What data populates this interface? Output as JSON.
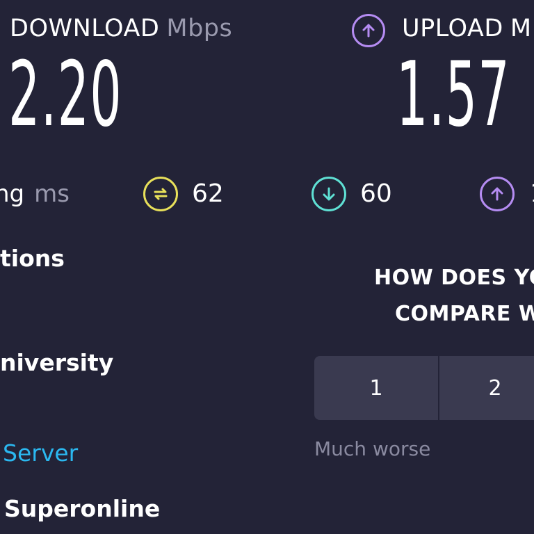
{
  "download": {
    "label": "DOWNLOAD",
    "unit": "Mbps",
    "value": "2.20"
  },
  "upload": {
    "label": "UPLOAD",
    "unit": "M",
    "value": "1.57"
  },
  "latency": {
    "label": "ng",
    "unit": "ms",
    "unloaded": "62",
    "download": "60",
    "upload": "1"
  },
  "left_panel": {
    "connections_title": "tions",
    "host_name": "niversity",
    "change_server_link": "Server",
    "provider_name": "Superonline"
  },
  "compare": {
    "question_line1": "HOW DOES YO",
    "question_line2": "COMPARE W",
    "options": [
      "1",
      "2"
    ],
    "hint_left": "Much worse"
  },
  "colors": {
    "background": "#232337",
    "ping_icon": "#e8e05a",
    "download_icon": "#5fe0d4",
    "upload_icon": "#b58cf2",
    "link": "#2bb8f0",
    "button_bg": "#3a3a50"
  },
  "icons": {
    "upload_header": "arrow-up-circle-icon",
    "ping": "ping-circle-icon",
    "download": "arrow-down-circle-icon",
    "upload": "arrow-up-circle-icon"
  }
}
